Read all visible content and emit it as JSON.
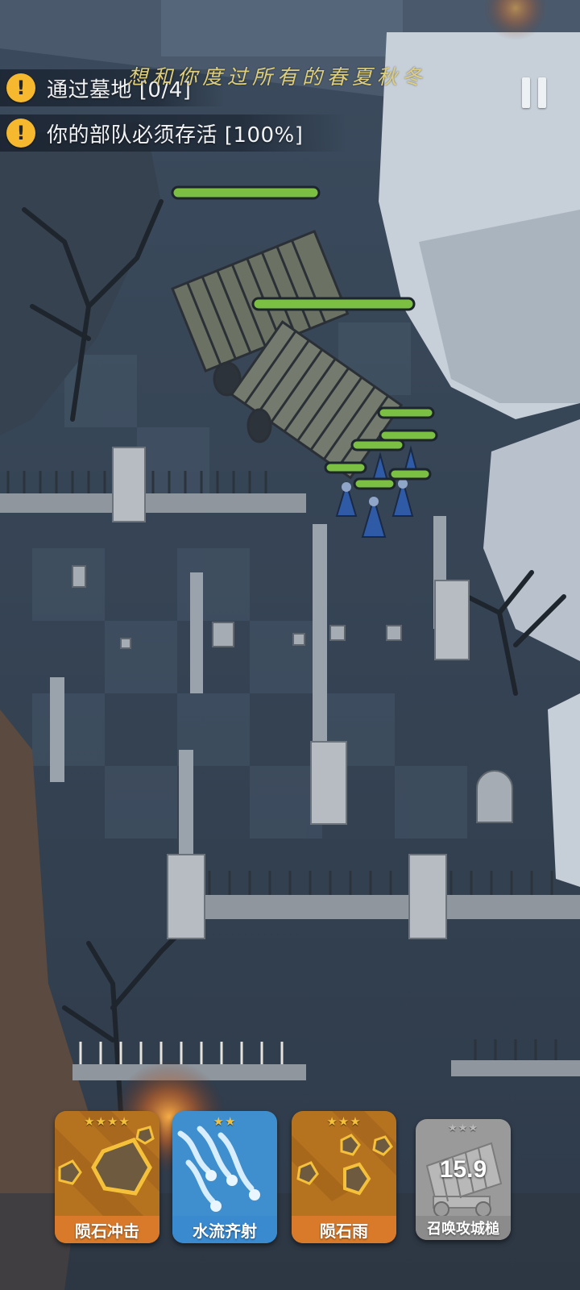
{
  "hud": {
    "objectives": [
      {
        "icon": "warning-icon",
        "symbol": "!",
        "text": "通过墓地 [0/4]"
      },
      {
        "icon": "warning-icon",
        "symbol": "!",
        "text": "你的部队必须存活 [100%]"
      }
    ],
    "watermark": "想和你度过所有的春夏秋冬",
    "pause_icon": "pause-icon"
  },
  "skills": [
    {
      "name": "陨石冲击",
      "stars": "★★★★",
      "star_count": 4,
      "theme": "#d87a2a",
      "icon": "meteor-strike-icon"
    },
    {
      "name": "水流齐射",
      "stars": "★★",
      "star_count": 2,
      "theme": "#3a8ad0",
      "icon": "water-volley-icon"
    },
    {
      "name": "陨石雨",
      "stars": "★★★",
      "star_count": 3,
      "theme": "#d87a2a",
      "icon": "meteor-rain-icon"
    },
    {
      "name": "召唤攻城槌",
      "stars": "★★★",
      "star_count": 3,
      "theme": "#8b8b8b",
      "icon": "battering-ram-icon",
      "cooldown": "15.9",
      "disabled": true
    }
  ],
  "colors": {
    "health_bar": "#7bc043",
    "warning": "#f5b82e",
    "ground": "#3d4d60",
    "wall": "#cfd5dc",
    "fire": "#f08a2c"
  }
}
